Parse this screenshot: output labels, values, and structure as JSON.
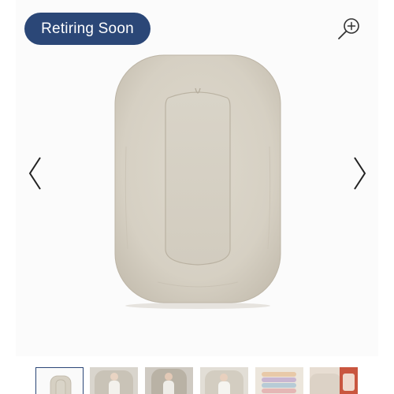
{
  "badge": {
    "label": "Retiring Soon",
    "color": "#2b4777"
  },
  "icons": {
    "zoom": "zoom-in-icon",
    "previous": "chevron-left-icon",
    "next": "chevron-right-icon"
  },
  "product": {
    "color": "#d8d2c6"
  },
  "thumbnails": {
    "count": 6,
    "selected_index": 1
  }
}
